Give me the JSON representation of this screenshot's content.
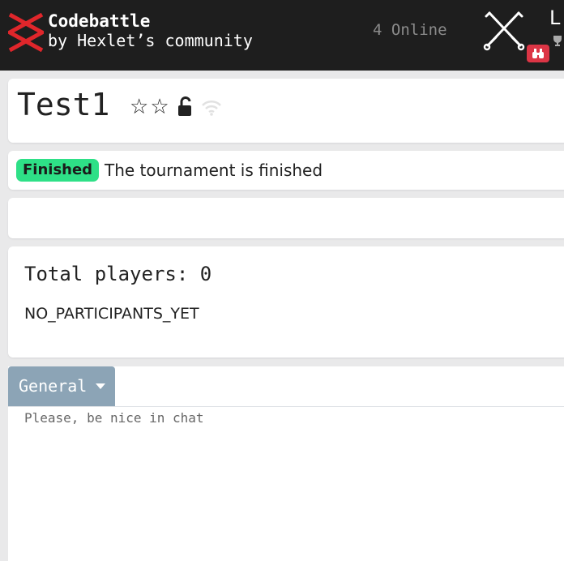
{
  "header": {
    "brand_title": "Codebattle",
    "brand_subtitle": "by Hexlet’s community",
    "online_status": "4 Online",
    "user_initial": "L",
    "icons": [
      "codebattle-logo-icon",
      "crossed-swords-icon",
      "binoculars-icon",
      "trophy-icon"
    ],
    "badge_color": "#dc3545"
  },
  "tournament": {
    "name": "Test1",
    "status_badge": "Finished",
    "status_text": "The tournament is finished",
    "badge_color": "#2ee087",
    "icons": [
      "star-outline-icon",
      "star-outline-icon",
      "lock-open-icon",
      "wifi-icon"
    ]
  },
  "players": {
    "title": "Total players: 0",
    "empty_message": "NO_PARTICIPANTS_YET"
  },
  "chat": {
    "tab_label": "General",
    "placeholder_message": "Please, be nice in chat",
    "tab_color": "#8ca4b6"
  }
}
